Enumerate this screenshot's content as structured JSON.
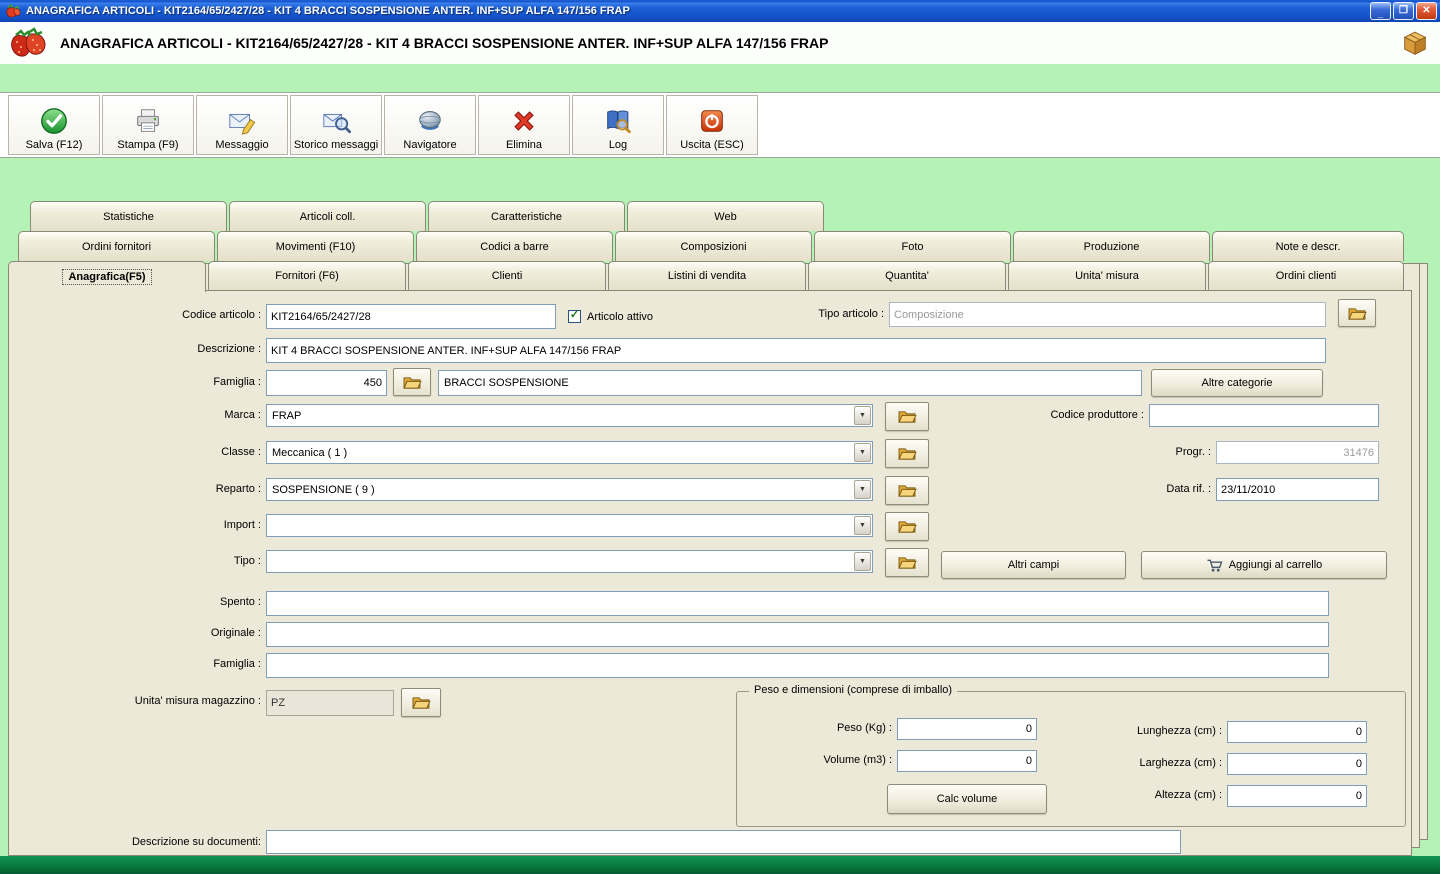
{
  "colors": {
    "window_background": "#b5f2b5",
    "titlebar_blue": "#1453c8",
    "panel_tan": "#ece9d8",
    "bottom_bar_green": "#09753e"
  },
  "titlebar": {
    "title": "ANAGRAFICA ARTICOLI - KIT2164/65/2427/28 - KIT 4 BRACCI SOSPENSIONE ANTER. INF+SUP ALFA 147/156 FRAP"
  },
  "header": {
    "title": "ANAGRAFICA ARTICOLI - KIT2164/65/2427/28 - KIT 4 BRACCI SOSPENSIONE ANTER. INF+SUP ALFA 147/156 FRAP"
  },
  "icons": {
    "minimize": "_",
    "restore": "❐",
    "close": "✕",
    "dropdown": "▼",
    "check": "✓"
  },
  "toolbar": {
    "buttons": [
      {
        "label": "Salva (F12)",
        "icon": "save-check-icon"
      },
      {
        "label": "Stampa (F9)",
        "icon": "printer-icon"
      },
      {
        "label": "Messaggio",
        "icon": "message-compose-icon"
      },
      {
        "label": "Storico messaggi",
        "icon": "message-history-icon"
      },
      {
        "label": "Navigatore",
        "icon": "navigator-globe-icon"
      },
      {
        "label": "Elimina",
        "icon": "delete-x-icon"
      },
      {
        "label": "Log",
        "icon": "log-book-icon"
      },
      {
        "label": "Uscita (ESC)",
        "icon": "exit-power-icon"
      }
    ]
  },
  "tabs": {
    "row1": [
      "Statistiche",
      "Articoli coll.",
      "Caratteristiche",
      "Web"
    ],
    "row2": [
      "Ordini fornitori",
      "Movimenti (F10)",
      "Codici a barre",
      "Composizioni",
      "Foto",
      "Produzione",
      "Note e descr."
    ],
    "row3": [
      "Anagrafica(F5)",
      "Fornitori (F6)",
      "Clienti",
      "Listini di vendita",
      "Quantita'",
      "Unita' misura",
      "Ordini clienti"
    ],
    "active_tab": "Anagrafica(F5)"
  },
  "form": {
    "codice_articolo": {
      "label": "Codice articolo :",
      "value": "KIT2164/65/2427/28"
    },
    "articolo_attivo": {
      "label": "Articolo attivo",
      "checked": true
    },
    "tipo_articolo": {
      "label": "Tipo articolo :",
      "value": "Composizione"
    },
    "descrizione": {
      "label": "Descrizione :",
      "value": "KIT 4 BRACCI SOSPENSIONE ANTER. INF+SUP ALFA 147/156 FRAP"
    },
    "famiglia": {
      "label": "Famiglia :",
      "code": "450",
      "name": "BRACCI SOSPENSIONE"
    },
    "altre_categorie_button": "Altre categorie",
    "marca": {
      "label": "Marca :",
      "value": "FRAP"
    },
    "codice_produttore": {
      "label": "Codice produttore :",
      "value": ""
    },
    "classe": {
      "label": "Classe :",
      "value": "Meccanica ( 1 )"
    },
    "progr": {
      "label": "Progr. :",
      "value": "31476"
    },
    "reparto": {
      "label": "Reparto :",
      "value": "SOSPENSIONE ( 9 )"
    },
    "data_rif": {
      "label": "Data rif. :",
      "value": "23/11/2010"
    },
    "import": {
      "label": "Import :",
      "value": ""
    },
    "tipo": {
      "label": "Tipo :",
      "value": ""
    },
    "altri_campi_button": "Altri campi",
    "aggiungi_carrello_button": "Aggiungi al carrello",
    "spento": {
      "label": "Spento :",
      "value": ""
    },
    "originale": {
      "label": "Originale :",
      "value": ""
    },
    "famiglia_2": {
      "label": "Famiglia :",
      "value": ""
    },
    "unita_misura_magazzino": {
      "label": "Unita' misura magazzino :",
      "value": "PZ"
    },
    "descrizione_documenti": {
      "label": "Descrizione su documenti:",
      "value": ""
    }
  },
  "peso_dimensioni": {
    "title": "Peso e dimensioni (comprese di imballo)",
    "peso": {
      "label": "Peso (Kg) :",
      "value": "0"
    },
    "volume": {
      "label": "Volume (m3) :",
      "value": "0"
    },
    "lunghezza": {
      "label": "Lunghezza (cm) :",
      "value": "0"
    },
    "larghezza": {
      "label": "Larghezza (cm) :",
      "value": "0"
    },
    "altezza": {
      "label": "Altezza (cm) :",
      "value": "0"
    },
    "calc_volume_button": "Calc volume"
  }
}
